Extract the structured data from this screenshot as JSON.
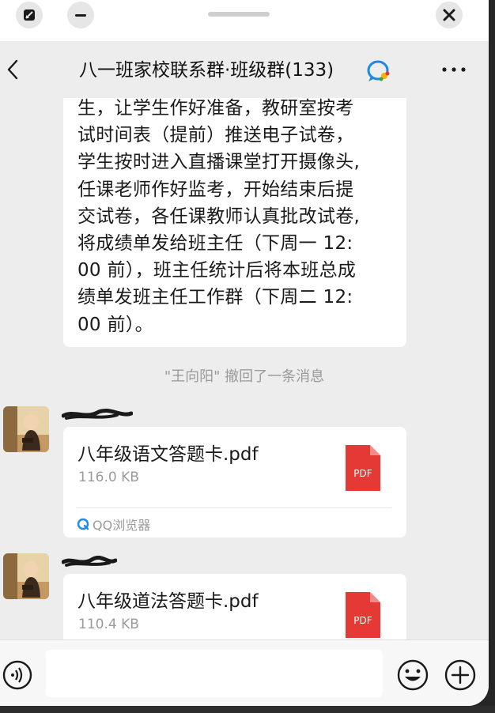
{
  "window": {
    "drag_handle": "drag-handle"
  },
  "header": {
    "title": "八一班家校联系群·班级群(133)",
    "back_icon": "chevron-left-icon",
    "group_icon": "qq-chat-icon",
    "more_icon": "more-dots-icon"
  },
  "messages": {
    "notice": {
      "lines": [
        "生，让学生作好准备，教研室按考",
        "试时间表（提前）推送电子试卷，",
        "学生按时进入直播课堂打开摄像头,",
        "任课老师作好监考，开始结束后提",
        "交试卷，各任课教师认真批改试卷,",
        "将成绩单发给班主任（下周一 12:",
        "00 前），班主任统计后将本班总成",
        "绩单发班主任工作群（下周二 12:",
        "00 前）。"
      ]
    },
    "system": "\"王向阳\" 撤回了一条消息",
    "files": [
      {
        "name": "八年级语文答题卡.pdf",
        "size": "116.0 KB",
        "type_label": "PDF",
        "source": "QQ浏览器"
      },
      {
        "name": "八年级道法答题卡.pdf",
        "size": "110.4 KB",
        "type_label": "PDF"
      }
    ]
  },
  "input": {
    "value": "",
    "placeholder": ""
  },
  "colors": {
    "chat_bg": "#ededed",
    "bubble_bg": "#ffffff",
    "pdf_red": "#e53935",
    "system_text": "#9a9a9a"
  }
}
